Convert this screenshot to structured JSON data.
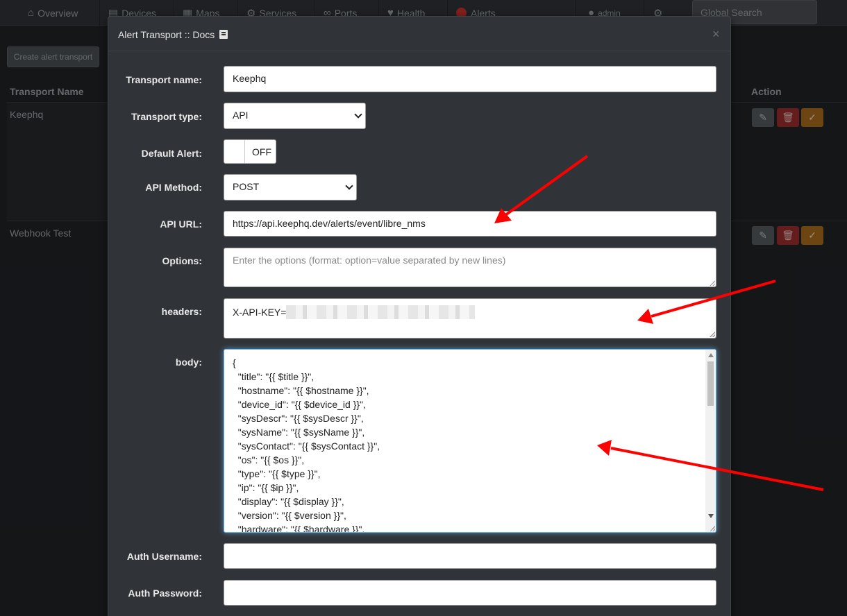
{
  "navbar": {
    "items": [
      {
        "label": "Overview",
        "icon": "home-icon"
      },
      {
        "label": "Devices",
        "icon": "server-icon"
      },
      {
        "label": "Maps",
        "icon": "map-icon"
      },
      {
        "label": "Services",
        "icon": "cogs-icon"
      },
      {
        "label": "Ports",
        "icon": "link-icon"
      },
      {
        "label": "Health",
        "icon": "heartbeat-icon"
      },
      {
        "label": "Alerts",
        "icon": "alert-icon"
      },
      {
        "label": "admin",
        "icon": "user-icon"
      }
    ],
    "settings_icon": "gear-icon",
    "search_placeholder": "Global Search"
  },
  "page": {
    "create_button": "Create alert transport",
    "columns": {
      "name": "Transport Name",
      "action": "Action"
    },
    "rows": [
      {
        "name": "Keephq"
      },
      {
        "name": "Webhook Test"
      }
    ]
  },
  "modal": {
    "title": "Alert Transport :: Docs",
    "close": "×",
    "fields": {
      "transport_name": {
        "label": "Transport name:",
        "value": "Keephq"
      },
      "transport_type": {
        "label": "Transport type:",
        "value": "API"
      },
      "default_alert": {
        "label": "Default Alert:",
        "value": "OFF"
      },
      "api_method": {
        "label": "API Method:",
        "value": "POST"
      },
      "api_url": {
        "label": "API URL:",
        "value": "https://api.keephq.dev/alerts/event/libre_nms"
      },
      "options": {
        "label": "Options:",
        "placeholder": "Enter the options (format: option=value separated by new lines)"
      },
      "headers": {
        "label": "headers:",
        "value": "X-API-KEY="
      },
      "body": {
        "label": "body:",
        "lines": [
          "{",
          "  \"title\": \"{{ $title }}\",",
          "  \"hostname\": \"{{ $hostname }}\",",
          "  \"device_id\": \"{{ $device_id }}\",",
          "  \"sysDescr\": \"{{ $sysDescr }}\",",
          "  \"sysName\": \"{{ $sysName }}\",",
          "  \"sysContact\": \"{{ $sysContact }}\",",
          "  \"os\": \"{{ $os }}\",",
          "  \"type\": \"{{ $type }}\",",
          "  \"ip\": \"{{ $ip }}\",",
          "  \"display\": \"{{ $display }}\",",
          "  \"version\": \"{{ $version }}\",",
          "  \"hardware\": \"{{ $hardware }}\","
        ]
      },
      "auth_username": {
        "label": "Auth Username:",
        "value": ""
      },
      "auth_password": {
        "label": "Auth Password:",
        "value": ""
      }
    }
  },
  "colors": {
    "annotation_arrow": "#ff0000",
    "focus_ring": "#66afe9"
  }
}
